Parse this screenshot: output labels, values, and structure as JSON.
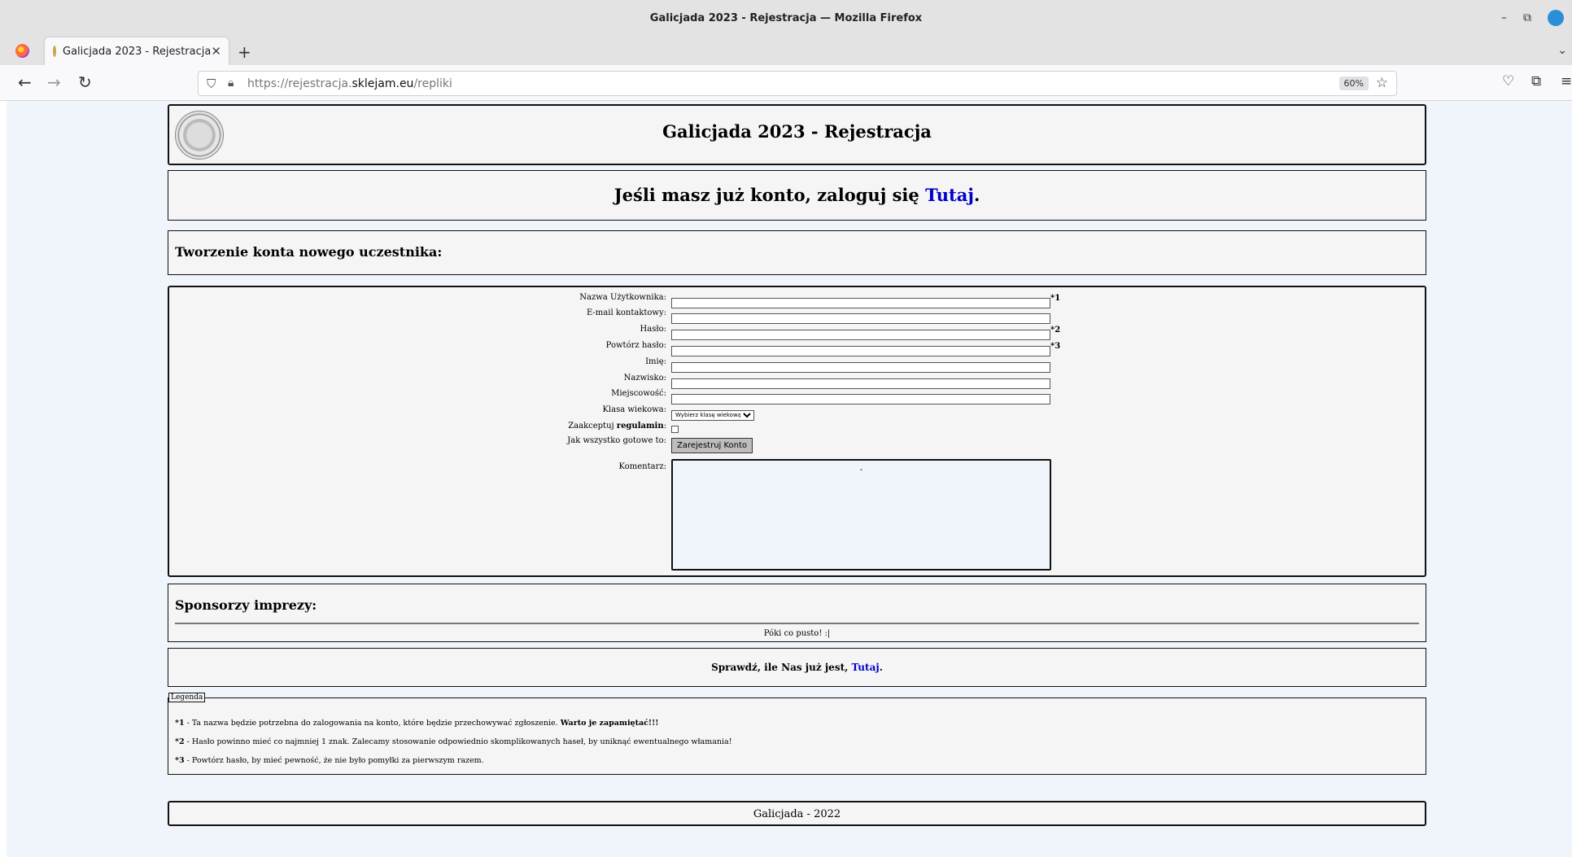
{
  "browser": {
    "window_title": "Galicjada 2023 - Rejestracja — Mozilla Firefox",
    "tab_title": "Galicjada 2023 - Rejestracja",
    "url_prefix": "https://rejestracja.",
    "url_host": "sklejam.eu",
    "url_path": "/repliki",
    "zoom": "60%"
  },
  "header": {
    "title": "Galicjada 2023 - Rejestracja"
  },
  "login": {
    "text": "Jeśli masz już konto, zaloguj się ",
    "link": "Tutaj",
    "suffix": "."
  },
  "create": {
    "title": "Tworzenie konta nowego uczestnika:"
  },
  "form": {
    "username_label": "Nazwa Użytkownika:",
    "username_mark": "*1",
    "email_label": "E-mail kontaktowy:",
    "password_label": "Hasło:",
    "password_mark": "*2",
    "password_repeat_label": "Powtórz hasło:",
    "password_repeat_mark": "*3",
    "firstname_label": "Imię:",
    "lastname_label": "Nazwisko:",
    "city_label": "Miejscowość:",
    "age_class_label": "Klasa wiekowa:",
    "age_class_selected": "Wybierz klasę wiekową",
    "accept_label_prefix": "Zaakceptuj ",
    "accept_label_bold": "regulamin",
    "accept_label_suffix": ":",
    "ready_label": "Jak wszystko gotowe to:",
    "register_button": "Zarejestruj Konto",
    "comment_label": "Komentarz:",
    "comment_value": "-"
  },
  "sponsors": {
    "title": "Sponsorzy imprezy:",
    "empty": "Póki co pusto! :|"
  },
  "count": {
    "text": "Sprawdź, ile Nas już jest, ",
    "link": "Tutaj",
    "suffix": "."
  },
  "legend": {
    "title": "Legenda",
    "items": [
      {
        "mark": "*1",
        "text": " - Ta nazwa będzie potrzebna do zalogowania na konto, które będzie przechowywać zgłoszenie. ",
        "bold": "Warto je zapamiętać!!!"
      },
      {
        "mark": "*2",
        "text": " - Hasło powinno mieć co najmniej 1 znak. Zalecamy stosowanie odpowiednio skomplikowanych haseł, by uniknąć ewentualnego włamania!",
        "bold": ""
      },
      {
        "mark": "*3",
        "text": " - Powtórz hasło, by mieć pewność, że nie było pomyłki za pierwszym razem.",
        "bold": ""
      }
    ]
  },
  "footer": {
    "text": "Galicjada - 2022"
  }
}
